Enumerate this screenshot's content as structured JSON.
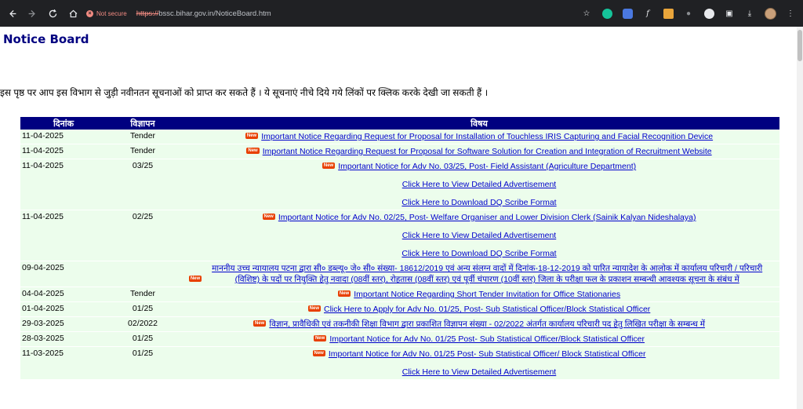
{
  "browser": {
    "security_label": "Not secure",
    "url_scheme": "https://",
    "url_rest": "bssc.bihar.gov.in/NoticeBoard.htm"
  },
  "page": {
    "title": "Notice Board",
    "intro": "इस पृष्ठ पर आप इस विभाग से जुड़ी नवीनतन सूचनाओं को प्राप्त कर सकते हैं । ये सूचनाएं नीचे दिये गये लिंकों पर क्लिक करके देखी जा सकती हैं ।"
  },
  "table": {
    "headers": {
      "date": "दिनांक",
      "adv": "विज्ञापन",
      "subject": "विषय"
    },
    "new_badge": "New",
    "rows": [
      {
        "date": "11-04-2025",
        "adv": "Tender",
        "subject": "Important Notice Regarding Request for Proposal for Installation of Touchless IRIS Capturing and Facial Recognition Device",
        "extra": []
      },
      {
        "date": "11-04-2025",
        "adv": "Tender",
        "subject": "Important Notice Regarding Request for Proposal for Software Solution for Creation and Integration of Recruitment Website",
        "extra": []
      },
      {
        "date": "11-04-2025",
        "adv": "03/25",
        "subject": "Important Notice for Adv No. 03/25, Post- Field Assistant (Agriculture Department)",
        "extra": [
          "Click Here to View Detailed Advertisement",
          "Click Here to Download DQ Scribe Format"
        ]
      },
      {
        "date": "11-04-2025",
        "adv": "02/25",
        "subject": "Important Notice for Adv No. 02/25, Post- Welfare Organiser and Lower Division Clerk (Sainik Kalyan Nideshalaya)",
        "extra": [
          "Click Here to View Detailed Advertisement",
          "Click Here to Download DQ Scribe Format"
        ]
      },
      {
        "date": "09-04-2025",
        "adv": "",
        "subject": "माननीय उच्च न्यायालय पटना द्वारा सी० डब्ल्यू० जे० सी० संख्या- 18612/2019 एवं अन्य संलग्न वादों में दिनांक-18-12-2019 को पारित न्यायादेश के आलोक में कार्यालय परिचारी / परिचारी (विशिष्ट) के पदों पर नियुक्ति हेतु नवादा (08वीं स्तर), रोहतास (08वीं स्तर) एवं पूर्वी चंपारण (10वीं स्तर) जिला के परीक्षा फल के प्रकाशन सम्बन्धी आवश्यक सूचना के संबंध में",
        "extra": []
      },
      {
        "date": "04-04-2025",
        "adv": "Tender",
        "subject": "Important Notice Regarding Short Tender Invitation for Office Stationaries",
        "extra": []
      },
      {
        "date": "01-04-2025",
        "adv": "01/25",
        "subject": "Click Here to Apply for Adv No. 01/25, Post- Sub Statistical Officer/Block Statistical Officer",
        "extra": []
      },
      {
        "date": "29-03-2025",
        "adv": "02/2022",
        "subject": "विज्ञान, प्रावैधिकी एवं तकनीकी शिक्षा विभाग द्वारा प्रकाशित विज्ञापन संख्या - 02/2022 अंतर्गत कार्यालय परिचारी पद हेतु लिखित परीक्षा के सम्बन्ध में",
        "extra": []
      },
      {
        "date": "28-03-2025",
        "adv": "01/25",
        "subject": "Important Notice for Adv No. 01/25 Post- Sub Statistical Officer/Block Statistical Officer",
        "extra": []
      },
      {
        "date": "11-03-2025",
        "adv": "01/25",
        "subject": "Important Notice for Adv No. 01/25 Post- Sub Statistical Officer/ Block Statistical Officer",
        "extra": [
          "Click Here to View Detailed Advertisement"
        ]
      }
    ]
  }
}
